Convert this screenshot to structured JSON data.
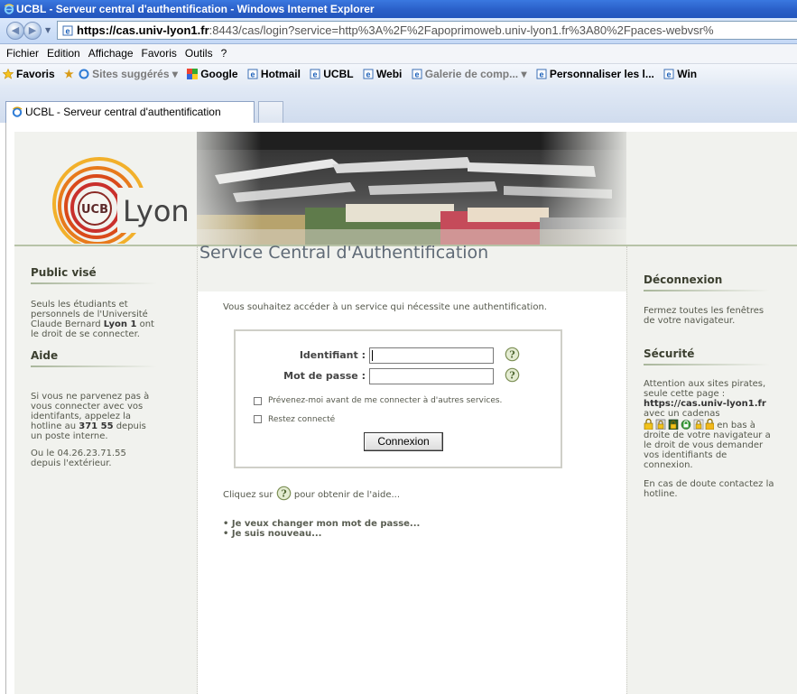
{
  "window": {
    "title": "UCBL - Serveur central d'authentification - Windows Internet Explorer"
  },
  "address": {
    "scheme": "https://",
    "host": "cas.univ-lyon1.fr",
    "rest": ":8443/cas/login?service=http%3A%2F%2Fapoprimoweb.univ-lyon1.fr%3A80%2Fpaces-webvsr%"
  },
  "menu": {
    "items": [
      "Fichier",
      "Edition",
      "Affichage",
      "Favoris",
      "Outils",
      "?"
    ]
  },
  "favorites": {
    "label": "Favoris",
    "items": [
      {
        "label": "Sites suggérés ▾",
        "dim": true
      },
      {
        "label": "Google",
        "dim": false
      },
      {
        "label": "Hotmail",
        "dim": false
      },
      {
        "label": "UCBL",
        "dim": false
      },
      {
        "label": "Webi",
        "dim": false
      },
      {
        "label": "Galerie de comp... ▾",
        "dim": true
      },
      {
        "label": "Personnaliser les l...",
        "dim": false
      },
      {
        "label": "Win",
        "dim": false
      }
    ]
  },
  "tab": {
    "label": "UCBL - Serveur central d'authentification"
  },
  "logo": {
    "text": "Lyon",
    "badge": "UCB"
  },
  "left": {
    "public_title": "Public visé",
    "public_l1": "Seuls les étudiants et",
    "public_l2": "personnels de l'Université",
    "public_l3a": "Claude Bernard ",
    "public_l3b": "Lyon 1",
    "public_l3c": " ont",
    "public_l4": "le droit de se connecter.",
    "aide_title": "Aide",
    "aide_l1": "Si vous ne parvenez pas à",
    "aide_l2": "vous connecter avec vos",
    "aide_l3": "identifants, appelez la",
    "aide_l4a": "hotline au ",
    "aide_l4b": "371 55",
    "aide_l4c": " depuis",
    "aide_l5": "un poste interne.",
    "aide_l6": "Ou le 04.26.23.71.55",
    "aide_l7": "depuis l'extérieur."
  },
  "main": {
    "title": "Service Central d'Authentification",
    "intro": "Vous souhaitez accéder à un service qui nécessite une authentification.",
    "id_label": "Identifiant :",
    "id_value": "",
    "pwd_label": "Mot de passe :",
    "pwd_value": "",
    "warn_label": "Prévenez-moi avant de me connecter à d'autres services.",
    "remember_label": "Restez connecté",
    "submit": "Connexion",
    "help_pre": "Cliquez sur",
    "help_post": "pour obtenir de l'aide...",
    "link_change": "Je veux changer mon mot de passe...",
    "link_new": "Je suis nouveau..."
  },
  "right": {
    "logout_title": "Déconnexion",
    "logout_l1": "Fermez toutes les fenêtres",
    "logout_l2": "de votre navigateur.",
    "sec_title": "Sécurité",
    "sec_l1": "Attention aux sites pirates,",
    "sec_l2": "seule cette page :",
    "sec_l3": "https://cas.univ-lyon1.fr",
    "sec_l4": "avec un cadenas",
    "sec_l5": "en bas à",
    "sec_l6": "droite de votre navigateur a",
    "sec_l7": "le droit de vous demander",
    "sec_l8": "vos identifiants de",
    "sec_l9": "connexion.",
    "doubt_l1": "En cas de doute contactez la",
    "doubt_l2": "hotline."
  },
  "colors": {
    "sidebar_bg": "#f1f2ee",
    "title_text": "#5f6a76",
    "ie_blue": "#2a5fc8"
  },
  "icons": {
    "help": "help-question-icon",
    "lock": "padlock-icon"
  }
}
